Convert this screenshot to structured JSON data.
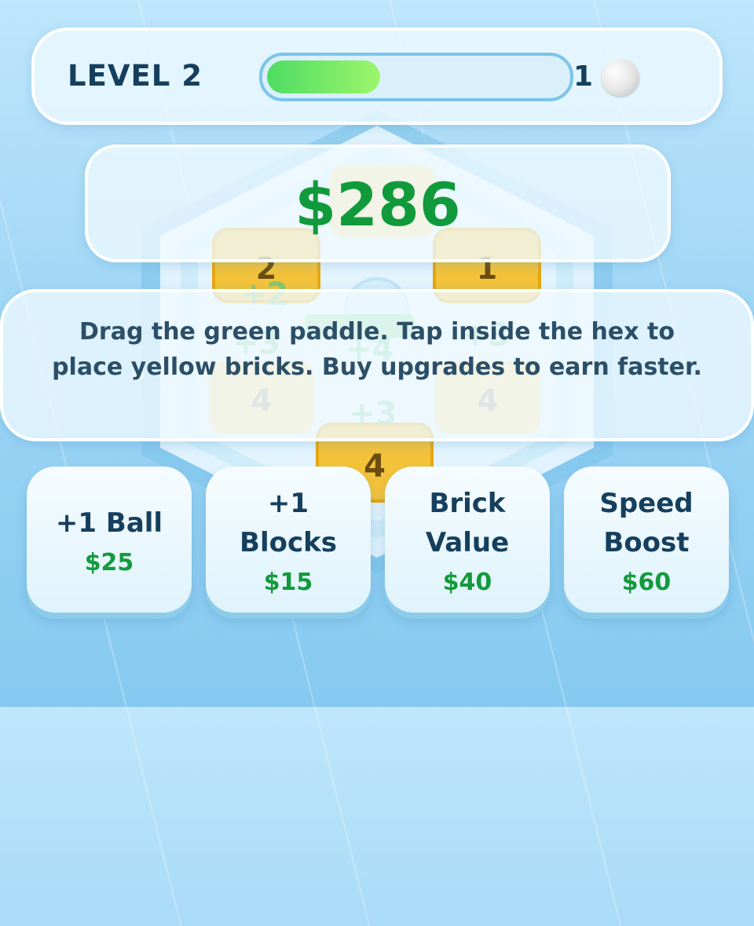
{
  "header": {
    "level_label": "LEVEL 2",
    "level_progress": 0.38,
    "ball_count": "1"
  },
  "money": "$286",
  "hint": "Drag the green paddle. Tap inside the hex to place yellow bricks. Buy upgrades to earn faster.",
  "board": {
    "bricks": [
      {
        "value": "",
        "state": "faded"
      },
      {
        "value": "2",
        "state": "gold"
      },
      {
        "value": "1",
        "state": "gold"
      },
      {
        "value": "4",
        "state": "faded"
      },
      {
        "value": "4",
        "state": "faded"
      },
      {
        "value": "4",
        "state": "gold"
      }
    ],
    "floating_texts": [
      "+2",
      "+3",
      "+4",
      "+3",
      "+3"
    ]
  },
  "upgrades": [
    {
      "title": "+1 Ball",
      "price": "$25"
    },
    {
      "title": "+1\nBlocks",
      "price": "$15"
    },
    {
      "title": "Brick\nValue",
      "price": "$40"
    },
    {
      "title": "Speed\nBoost",
      "price": "$60"
    }
  ],
  "colors": {
    "money": "#119a3c",
    "price": "#139a3c",
    "progress_fill": "#6ee864",
    "brick_gold": "#f3c23a"
  }
}
